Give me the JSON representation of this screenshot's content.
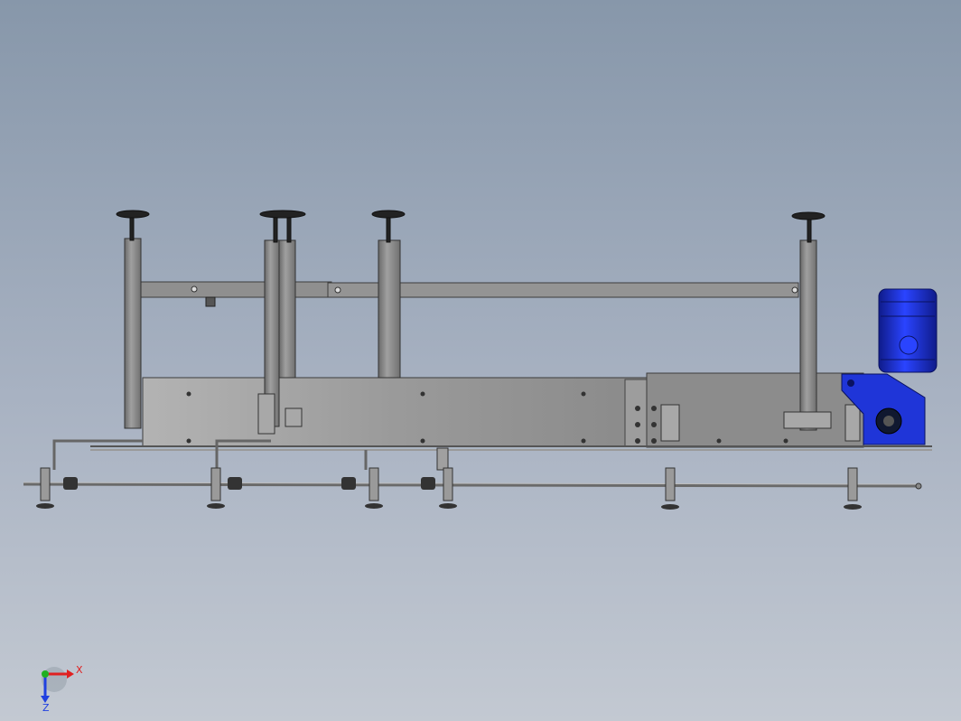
{
  "viewport": {
    "background_top": "#8797aa",
    "background_bottom": "#c3c9d2"
  },
  "model": {
    "frame_color": "#8c8c8c",
    "frame_dark": "#5a5a5a",
    "motor_color": "#1a2fd6",
    "motor_dark": "#0f1b8a"
  },
  "triad": {
    "x_label": "X",
    "z_label": "Z",
    "x_color": "#e02020",
    "y_color": "#20b020",
    "z_color": "#2040e0"
  }
}
